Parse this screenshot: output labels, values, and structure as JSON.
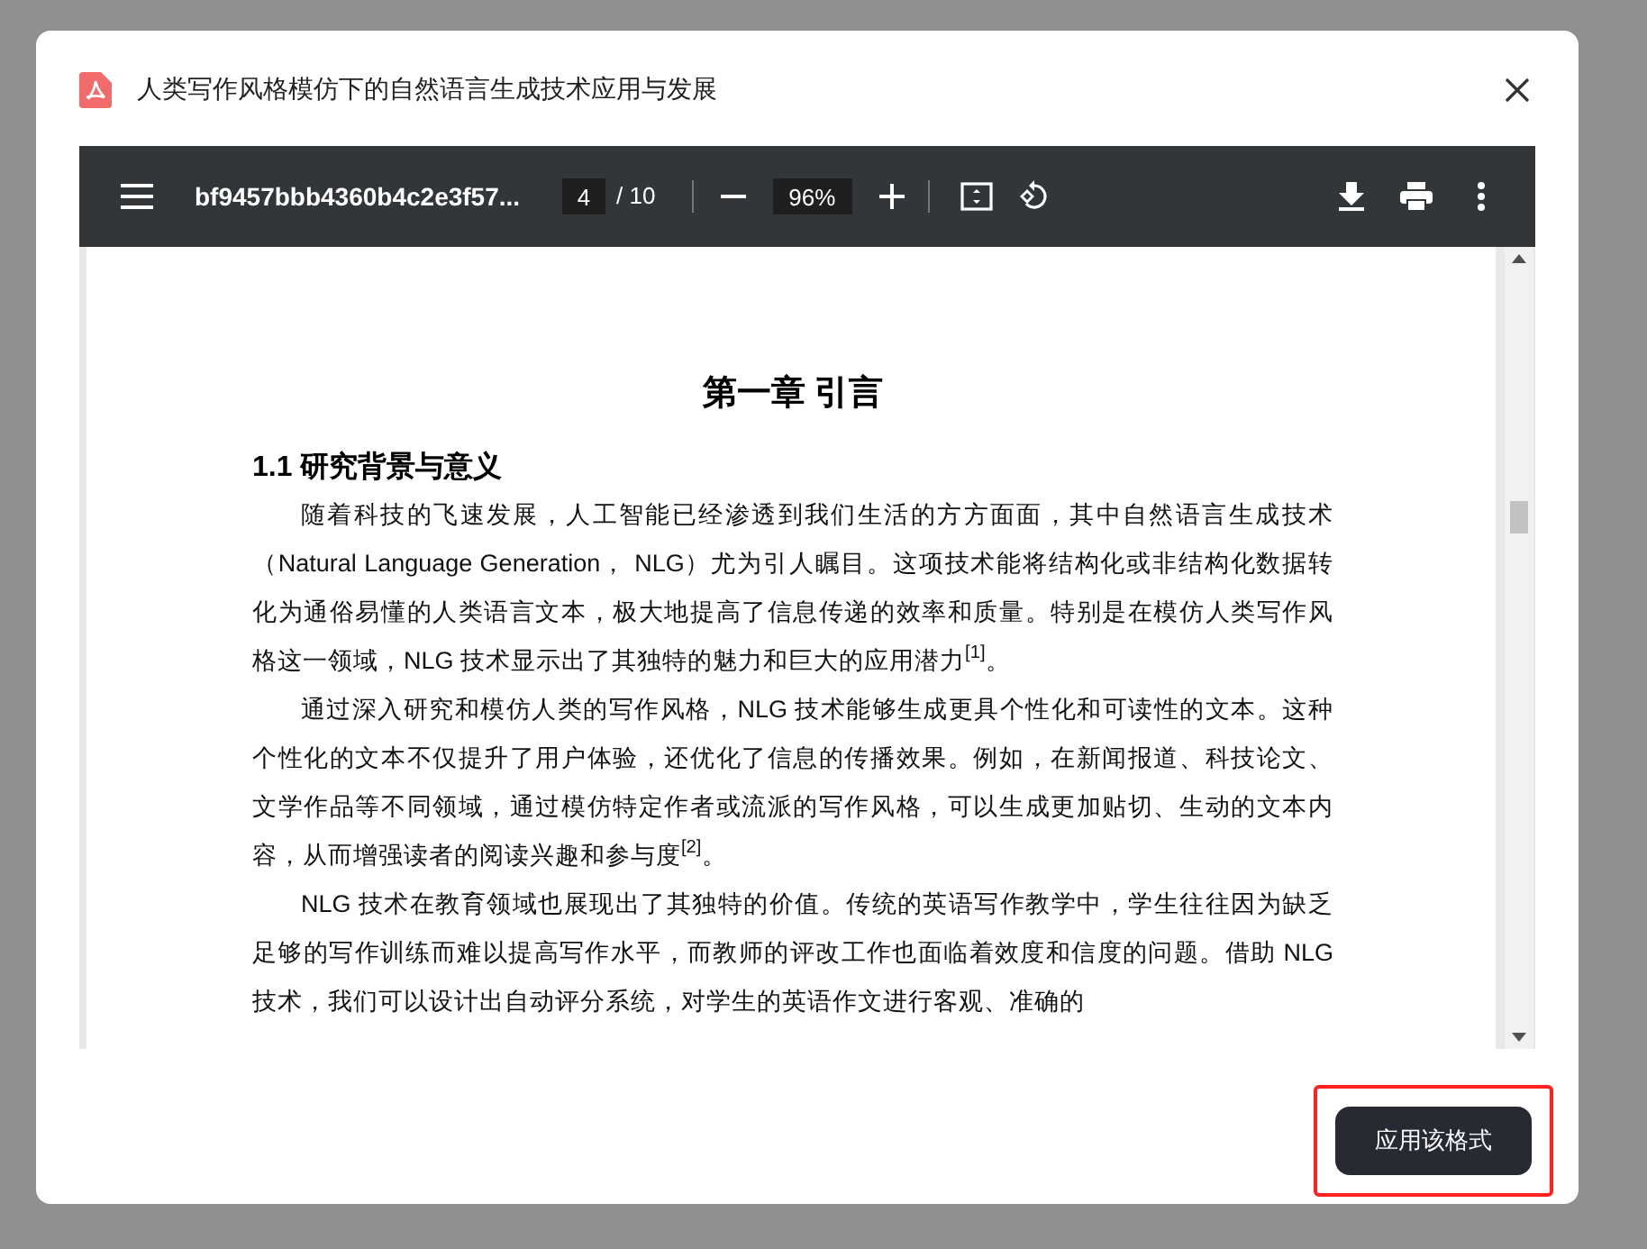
{
  "dialog": {
    "title": "人类写作风格模仿下的自然语言生成技术应用与发展"
  },
  "viewer": {
    "file_name": "bf9457bbb4360b4c2e3f57...",
    "page": "4",
    "page_total": "/ 10",
    "zoom": "96%"
  },
  "document": {
    "chapter_title": "第一章  引言",
    "section_title": "1.1  研究背景与意义",
    "paragraphs": [
      "随着科技的飞速发展，人工智能已经渗透到我们生活的方方面面，其中自然语言生成技术（Natural Language Generation， NLG）尤为引人瞩目。这项技术能将结构化或非结构化数据转化为通俗易懂的人类语言文本，极大地提高了信息传递的效率和质量。特别是在模仿人类写作风格这一领域，NLG 技术显示出了其独特的魅力和巨大的应用潜力$^{[1]}$。",
      "通过深入研究和模仿人类的写作风格，NLG 技术能够生成更具个性化和可读性的文本。这种个性化的文本不仅提升了用户体验，还优化了信息的传播效果。例如，在新闻报道、科技论文、文学作品等不同领域，通过模仿特定作者或流派的写作风格，可以生成更加贴切、生动的文本内容，从而增强读者的阅读兴趣和参与度$^{[2]}$。",
      "NLG 技术在教育领域也展现出了其独特的价值。传统的英语写作教学中，学生往往因为缺乏足够的写作训练而难以提高写作水平，而教师的评改工作也面临着效度和信度的问题。借助 NLG 技术，我们可以设计出自动评分系统，对学生的英语作文进行客观、准确的"
    ]
  },
  "footer": {
    "button": "应用该格式",
    "highlighted": true
  }
}
